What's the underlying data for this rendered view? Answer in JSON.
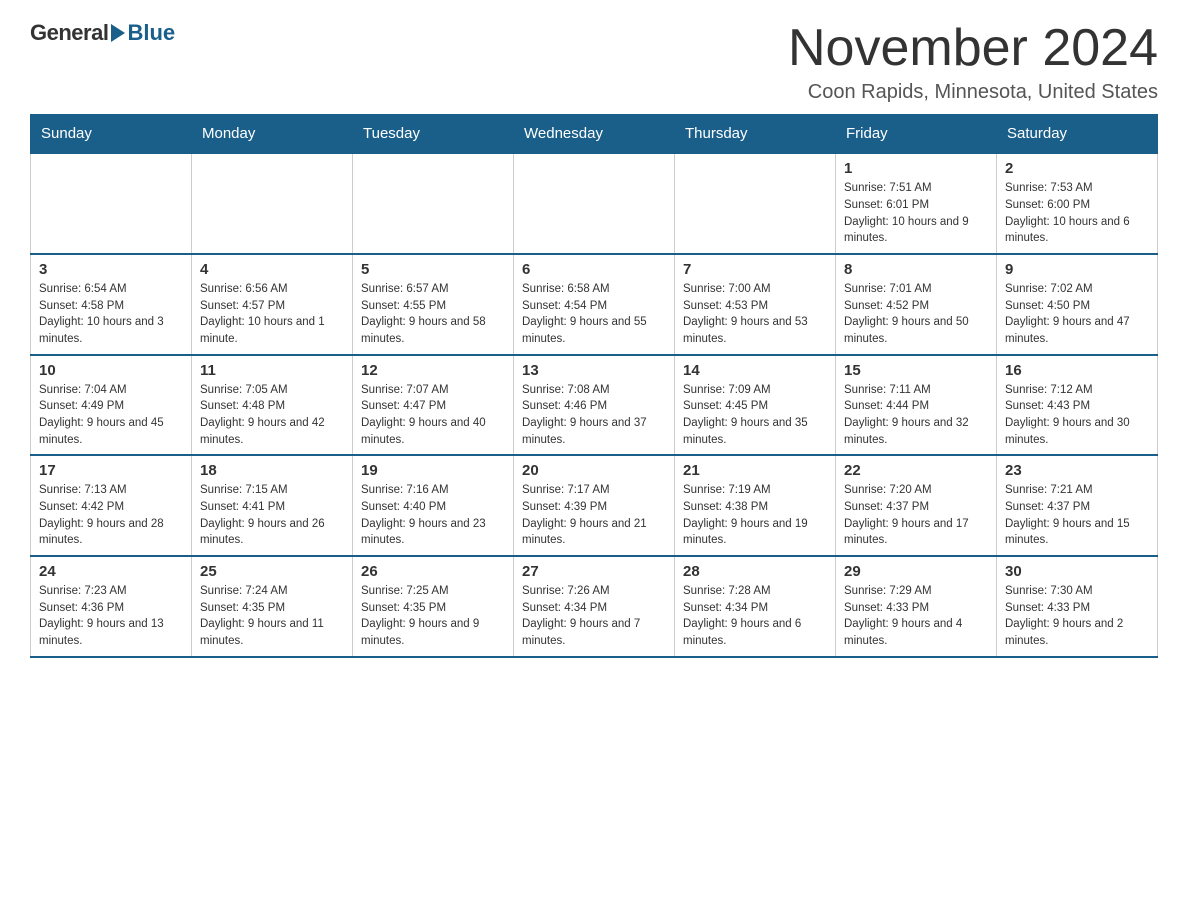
{
  "header": {
    "logo_general": "General",
    "logo_blue": "Blue",
    "month_title": "November 2024",
    "location": "Coon Rapids, Minnesota, United States"
  },
  "weekdays": [
    "Sunday",
    "Monday",
    "Tuesday",
    "Wednesday",
    "Thursday",
    "Friday",
    "Saturday"
  ],
  "weeks": [
    [
      {
        "day": "",
        "sunrise": "",
        "sunset": "",
        "daylight": "",
        "empty": true
      },
      {
        "day": "",
        "sunrise": "",
        "sunset": "",
        "daylight": "",
        "empty": true
      },
      {
        "day": "",
        "sunrise": "",
        "sunset": "",
        "daylight": "",
        "empty": true
      },
      {
        "day": "",
        "sunrise": "",
        "sunset": "",
        "daylight": "",
        "empty": true
      },
      {
        "day": "",
        "sunrise": "",
        "sunset": "",
        "daylight": "",
        "empty": true
      },
      {
        "day": "1",
        "sunrise": "Sunrise: 7:51 AM",
        "sunset": "Sunset: 6:01 PM",
        "daylight": "Daylight: 10 hours and 9 minutes.",
        "empty": false
      },
      {
        "day": "2",
        "sunrise": "Sunrise: 7:53 AM",
        "sunset": "Sunset: 6:00 PM",
        "daylight": "Daylight: 10 hours and 6 minutes.",
        "empty": false
      }
    ],
    [
      {
        "day": "3",
        "sunrise": "Sunrise: 6:54 AM",
        "sunset": "Sunset: 4:58 PM",
        "daylight": "Daylight: 10 hours and 3 minutes.",
        "empty": false
      },
      {
        "day": "4",
        "sunrise": "Sunrise: 6:56 AM",
        "sunset": "Sunset: 4:57 PM",
        "daylight": "Daylight: 10 hours and 1 minute.",
        "empty": false
      },
      {
        "day": "5",
        "sunrise": "Sunrise: 6:57 AM",
        "sunset": "Sunset: 4:55 PM",
        "daylight": "Daylight: 9 hours and 58 minutes.",
        "empty": false
      },
      {
        "day": "6",
        "sunrise": "Sunrise: 6:58 AM",
        "sunset": "Sunset: 4:54 PM",
        "daylight": "Daylight: 9 hours and 55 minutes.",
        "empty": false
      },
      {
        "day": "7",
        "sunrise": "Sunrise: 7:00 AM",
        "sunset": "Sunset: 4:53 PM",
        "daylight": "Daylight: 9 hours and 53 minutes.",
        "empty": false
      },
      {
        "day": "8",
        "sunrise": "Sunrise: 7:01 AM",
        "sunset": "Sunset: 4:52 PM",
        "daylight": "Daylight: 9 hours and 50 minutes.",
        "empty": false
      },
      {
        "day": "9",
        "sunrise": "Sunrise: 7:02 AM",
        "sunset": "Sunset: 4:50 PM",
        "daylight": "Daylight: 9 hours and 47 minutes.",
        "empty": false
      }
    ],
    [
      {
        "day": "10",
        "sunrise": "Sunrise: 7:04 AM",
        "sunset": "Sunset: 4:49 PM",
        "daylight": "Daylight: 9 hours and 45 minutes.",
        "empty": false
      },
      {
        "day": "11",
        "sunrise": "Sunrise: 7:05 AM",
        "sunset": "Sunset: 4:48 PM",
        "daylight": "Daylight: 9 hours and 42 minutes.",
        "empty": false
      },
      {
        "day": "12",
        "sunrise": "Sunrise: 7:07 AM",
        "sunset": "Sunset: 4:47 PM",
        "daylight": "Daylight: 9 hours and 40 minutes.",
        "empty": false
      },
      {
        "day": "13",
        "sunrise": "Sunrise: 7:08 AM",
        "sunset": "Sunset: 4:46 PM",
        "daylight": "Daylight: 9 hours and 37 minutes.",
        "empty": false
      },
      {
        "day": "14",
        "sunrise": "Sunrise: 7:09 AM",
        "sunset": "Sunset: 4:45 PM",
        "daylight": "Daylight: 9 hours and 35 minutes.",
        "empty": false
      },
      {
        "day": "15",
        "sunrise": "Sunrise: 7:11 AM",
        "sunset": "Sunset: 4:44 PM",
        "daylight": "Daylight: 9 hours and 32 minutes.",
        "empty": false
      },
      {
        "day": "16",
        "sunrise": "Sunrise: 7:12 AM",
        "sunset": "Sunset: 4:43 PM",
        "daylight": "Daylight: 9 hours and 30 minutes.",
        "empty": false
      }
    ],
    [
      {
        "day": "17",
        "sunrise": "Sunrise: 7:13 AM",
        "sunset": "Sunset: 4:42 PM",
        "daylight": "Daylight: 9 hours and 28 minutes.",
        "empty": false
      },
      {
        "day": "18",
        "sunrise": "Sunrise: 7:15 AM",
        "sunset": "Sunset: 4:41 PM",
        "daylight": "Daylight: 9 hours and 26 minutes.",
        "empty": false
      },
      {
        "day": "19",
        "sunrise": "Sunrise: 7:16 AM",
        "sunset": "Sunset: 4:40 PM",
        "daylight": "Daylight: 9 hours and 23 minutes.",
        "empty": false
      },
      {
        "day": "20",
        "sunrise": "Sunrise: 7:17 AM",
        "sunset": "Sunset: 4:39 PM",
        "daylight": "Daylight: 9 hours and 21 minutes.",
        "empty": false
      },
      {
        "day": "21",
        "sunrise": "Sunrise: 7:19 AM",
        "sunset": "Sunset: 4:38 PM",
        "daylight": "Daylight: 9 hours and 19 minutes.",
        "empty": false
      },
      {
        "day": "22",
        "sunrise": "Sunrise: 7:20 AM",
        "sunset": "Sunset: 4:37 PM",
        "daylight": "Daylight: 9 hours and 17 minutes.",
        "empty": false
      },
      {
        "day": "23",
        "sunrise": "Sunrise: 7:21 AM",
        "sunset": "Sunset: 4:37 PM",
        "daylight": "Daylight: 9 hours and 15 minutes.",
        "empty": false
      }
    ],
    [
      {
        "day": "24",
        "sunrise": "Sunrise: 7:23 AM",
        "sunset": "Sunset: 4:36 PM",
        "daylight": "Daylight: 9 hours and 13 minutes.",
        "empty": false
      },
      {
        "day": "25",
        "sunrise": "Sunrise: 7:24 AM",
        "sunset": "Sunset: 4:35 PM",
        "daylight": "Daylight: 9 hours and 11 minutes.",
        "empty": false
      },
      {
        "day": "26",
        "sunrise": "Sunrise: 7:25 AM",
        "sunset": "Sunset: 4:35 PM",
        "daylight": "Daylight: 9 hours and 9 minutes.",
        "empty": false
      },
      {
        "day": "27",
        "sunrise": "Sunrise: 7:26 AM",
        "sunset": "Sunset: 4:34 PM",
        "daylight": "Daylight: 9 hours and 7 minutes.",
        "empty": false
      },
      {
        "day": "28",
        "sunrise": "Sunrise: 7:28 AM",
        "sunset": "Sunset: 4:34 PM",
        "daylight": "Daylight: 9 hours and 6 minutes.",
        "empty": false
      },
      {
        "day": "29",
        "sunrise": "Sunrise: 7:29 AM",
        "sunset": "Sunset: 4:33 PM",
        "daylight": "Daylight: 9 hours and 4 minutes.",
        "empty": false
      },
      {
        "day": "30",
        "sunrise": "Sunrise: 7:30 AM",
        "sunset": "Sunset: 4:33 PM",
        "daylight": "Daylight: 9 hours and 2 minutes.",
        "empty": false
      }
    ]
  ]
}
